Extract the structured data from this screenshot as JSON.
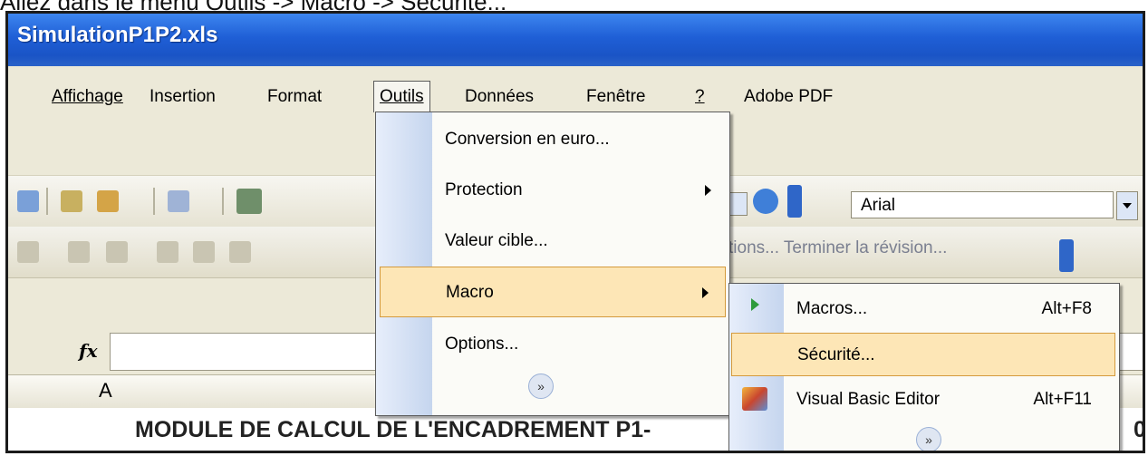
{
  "instruction": "Allez dans le menu Outils -> Macro -> Sécurité...",
  "window": {
    "title": "SimulationP1P2.xls"
  },
  "menubar": {
    "items": [
      {
        "name": "affichage",
        "label": "Affichage"
      },
      {
        "name": "insertion",
        "label": "Insertion"
      },
      {
        "name": "format",
        "label": "Format"
      },
      {
        "name": "outils",
        "label": "Outils",
        "active": true
      },
      {
        "name": "donnees",
        "label": "Données"
      },
      {
        "name": "fenetre",
        "label": "Fenêtre"
      },
      {
        "name": "help",
        "label": "?"
      },
      {
        "name": "adobe-pdf",
        "label": "Adobe PDF"
      }
    ]
  },
  "outils_menu": {
    "items": [
      {
        "label": "Conversion en euro..."
      },
      {
        "label": "Protection",
        "has_submenu": true
      },
      {
        "label": "Valeur cible..."
      },
      {
        "label": "Macro",
        "has_submenu": true,
        "highlighted": true
      },
      {
        "label": "Options..."
      }
    ],
    "expand_label": "»"
  },
  "macro_submenu": {
    "items": [
      {
        "label": "Macros...",
        "shortcut": "Alt+F8"
      },
      {
        "label": "Sécurité...",
        "highlighted": true
      },
      {
        "label": "Visual Basic Editor",
        "shortcut": "Alt+F11"
      }
    ],
    "expand_label": "»"
  },
  "toolbar": {
    "font_name": "Arial",
    "review_text": "tions... Terminer la révision..."
  },
  "formula_bar": {
    "fx_label": "fx",
    "value": ""
  },
  "sheet": {
    "column_header": "A",
    "cell_text": "MODULE DE CALCUL DE L'ENCADREMENT P1-"
  },
  "colors": {
    "title_blue": "#1f5fd6",
    "menu_highlight": "#fde6b6",
    "menu_gutter": "#c5d5ee"
  }
}
